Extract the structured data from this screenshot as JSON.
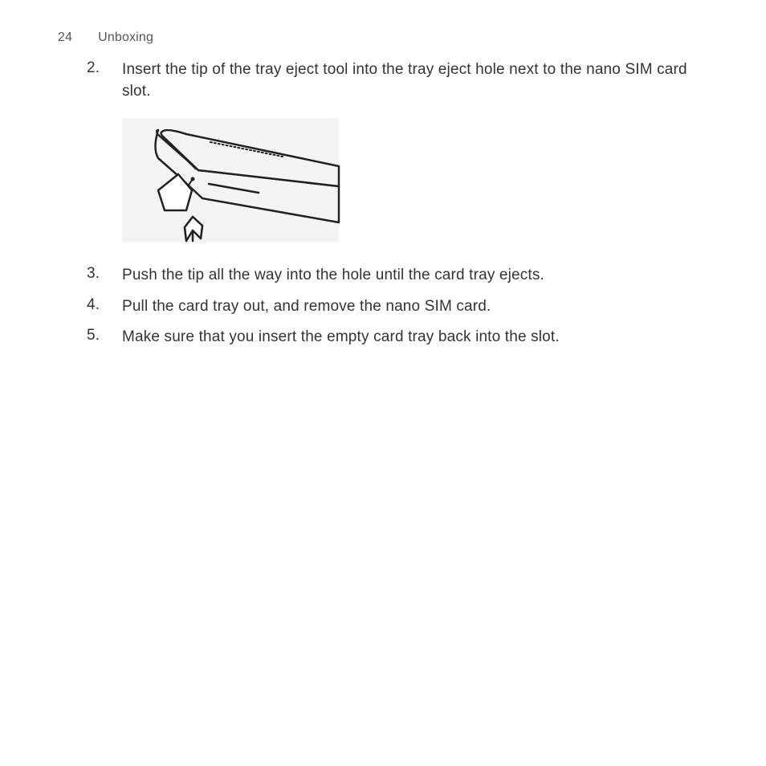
{
  "header": {
    "page_number": "24",
    "section": "Unboxing"
  },
  "steps": [
    {
      "num": "2.",
      "text": "Insert the tip of the tray eject tool into the tray eject hole next to the nano SIM card slot."
    },
    {
      "num": "3.",
      "text": "Push the tip all the way into the hole until the card tray ejects."
    },
    {
      "num": "4.",
      "text": "Pull the card tray out, and remove the nano SIM card."
    },
    {
      "num": "5.",
      "text": "Make sure that you insert the empty card tray back into the slot."
    }
  ]
}
